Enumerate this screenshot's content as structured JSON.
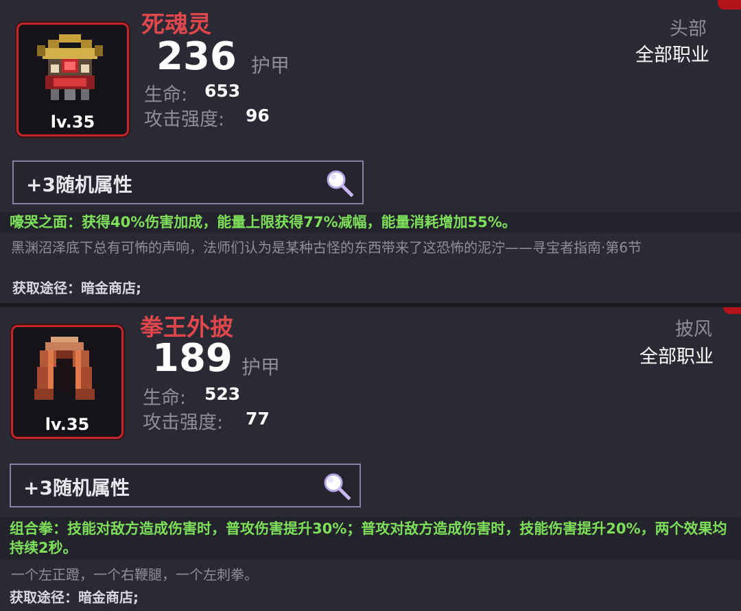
{
  "items": [
    {
      "name": "死魂灵",
      "level": "lv.35",
      "armor_value": "236",
      "armor_label": "护甲",
      "hp_label": "生命:",
      "hp_value": "653",
      "atk_label": "攻击强度:",
      "atk_value": "96",
      "slot": "头部",
      "class_req": "全部职业",
      "random_attr": "+3随机属性",
      "effect": "嚎哭之面：获得40%伤害加成，能量上限获得77%减幅，能量消耗增加55%。",
      "description": "黑渊沼泽底下总有可怖的声响，法师们认为是某种古怪的东西带来了这恐怖的泥泞——寻宝者指南·第6节",
      "source": "获取途径：暗金商店;",
      "icon": "skull-helm-icon"
    },
    {
      "name": "拳王外披",
      "level": "lv.35",
      "armor_value": "189",
      "armor_label": "护甲",
      "hp_label": "生命:",
      "hp_value": "523",
      "atk_label": "攻击强度:",
      "atk_value": "77",
      "slot": "披风",
      "class_req": "全部职业",
      "random_attr": "+3随机属性",
      "effect": "组合拳：技能对敌方造成伤害时，普攻伤害提升30%；普攻对敌方造成伤害时，技能伤害提升20%，两个效果均持续2秒。",
      "description": "一个左正蹬，一个右鞭腿，一个左刺拳。",
      "source": "获取途径：暗金商店;",
      "icon": "cloak-icon"
    }
  ],
  "colors": {
    "name": "#e0474d",
    "effect": "#7ee05a",
    "frame": "#c4262c",
    "background": "#2a2a35"
  }
}
